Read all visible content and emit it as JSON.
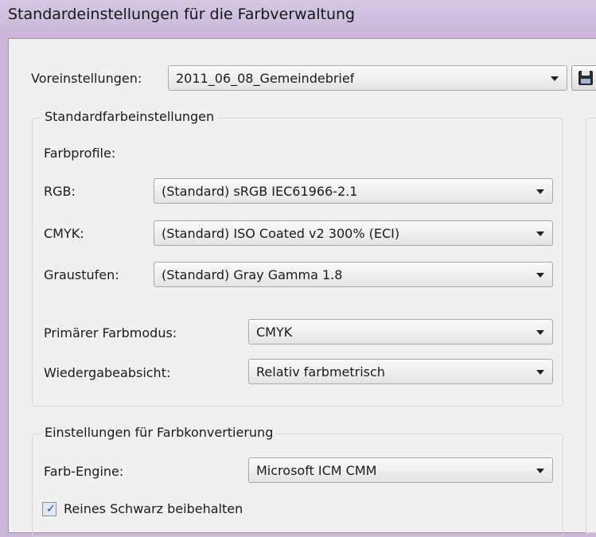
{
  "window": {
    "title": "Standardeinstellungen für die Farbverwaltung"
  },
  "presets": {
    "label": "Voreinstellungen:",
    "value": "2011_06_08_Gemeindebrief"
  },
  "standard_color_settings": {
    "title": "Standardfarbeinstellungen",
    "profiles_label": "Farbprofile:",
    "rgb": {
      "label": "RGB:",
      "value": "(Standard) sRGB IEC61966-2.1"
    },
    "cmyk": {
      "label": "CMYK:",
      "value": "(Standard) ISO Coated v2 300% (ECI)"
    },
    "grayscale": {
      "label": "Graustufen:",
      "value": "(Standard) Gray Gamma 1.8"
    },
    "primary_mode": {
      "label": "Primärer Farbmodus:",
      "value": "CMYK"
    },
    "rendering_intent": {
      "label": "Wiedergabeabsicht:",
      "value": "Relativ farbmetrisch"
    }
  },
  "conversion_settings": {
    "title": "Einstellungen für Farbkonvertierung",
    "engine": {
      "label": "Farb-Engine:",
      "value": "Microsoft ICM CMM"
    },
    "preserve_black": {
      "label": "Reines Schwarz beibehalten",
      "checked": true
    }
  },
  "icons": {
    "save": "floppy-disk-icon",
    "dropdown": "chevron-down-icon"
  }
}
